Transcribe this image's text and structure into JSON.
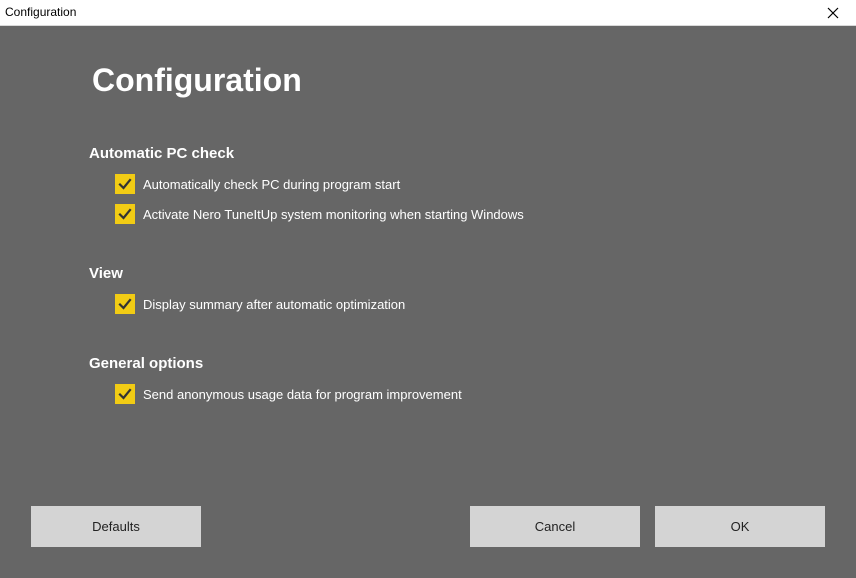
{
  "window": {
    "title": "Configuration"
  },
  "heading": "Configuration",
  "sections": [
    {
      "title": "Automatic PC check",
      "options": [
        {
          "label": "Automatically check PC during program start",
          "checked": true
        },
        {
          "label": "Activate Nero TuneItUp system monitoring when starting Windows",
          "checked": true
        }
      ]
    },
    {
      "title": "View",
      "options": [
        {
          "label": "Display summary after automatic optimization",
          "checked": true
        }
      ]
    },
    {
      "title": "General options",
      "options": [
        {
          "label": "Send anonymous usage data for program improvement",
          "checked": true
        }
      ]
    }
  ],
  "buttons": {
    "defaults": "Defaults",
    "cancel": "Cancel",
    "ok": "OK"
  },
  "colors": {
    "background": "#666666",
    "checkbox_accent": "#f2cc14",
    "button_bg": "#d4d4d4"
  }
}
